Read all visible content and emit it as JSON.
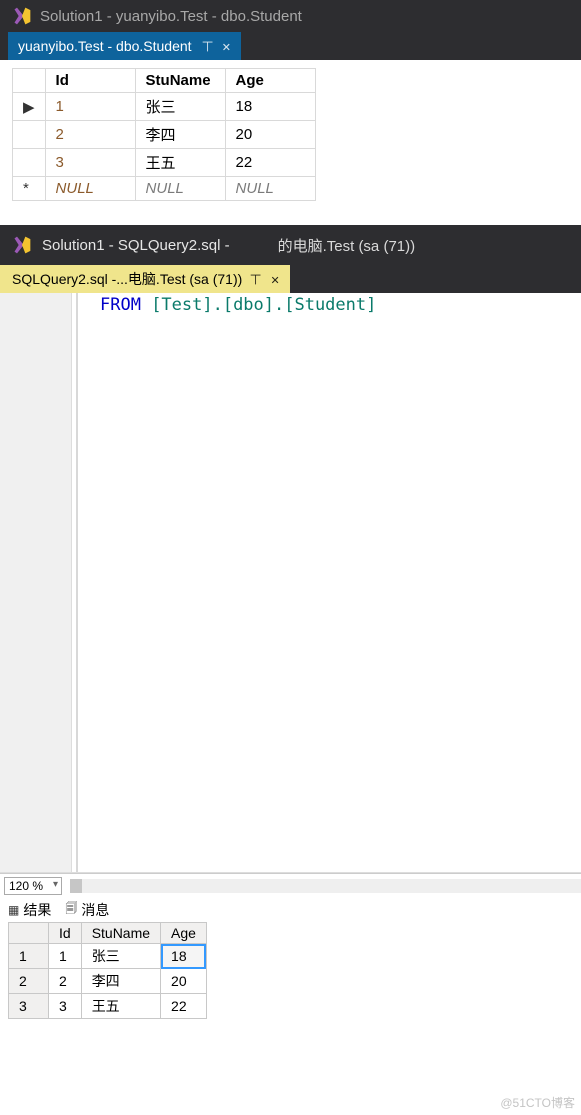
{
  "window1": {
    "title": "Solution1 - yuanyibo.Test - dbo.Student",
    "tab_label": "yuanyibo.Test - dbo.Student"
  },
  "grid": {
    "columns": [
      "Id",
      "StuName",
      "Age"
    ],
    "rows": [
      {
        "marker": "▶",
        "id": "1",
        "stu": "张三",
        "age": "18",
        "null": false
      },
      {
        "marker": "",
        "id": "2",
        "stu": "李四",
        "age": "20",
        "null": false
      },
      {
        "marker": "",
        "id": "3",
        "stu": "王五",
        "age": "22",
        "null": false
      },
      {
        "marker": "*",
        "id": "NULL",
        "stu": "NULL",
        "age": "NULL",
        "null": true
      }
    ]
  },
  "window2": {
    "title": "Solution1 - SQLQuery2.sql -",
    "conn": "的电脑.Test (sa (71))",
    "tab_label": "SQLQuery2.sql -...电脑.Test (sa (71))"
  },
  "sql": {
    "kw": "FROM",
    "line": " [Test].[dbo].[Student]"
  },
  "zoom": "120 %",
  "results_tabs": {
    "results": "结果",
    "messages": "消息"
  },
  "results": {
    "columns": [
      "",
      "Id",
      "StuName",
      "Age"
    ],
    "rows": [
      {
        "n": "1",
        "id": "1",
        "stu": "张三",
        "age": "18",
        "sel": true
      },
      {
        "n": "2",
        "id": "2",
        "stu": "李四",
        "age": "20",
        "sel": false
      },
      {
        "n": "3",
        "id": "3",
        "stu": "王五",
        "age": "22",
        "sel": false
      }
    ]
  },
  "watermark": "@51CTO博客"
}
